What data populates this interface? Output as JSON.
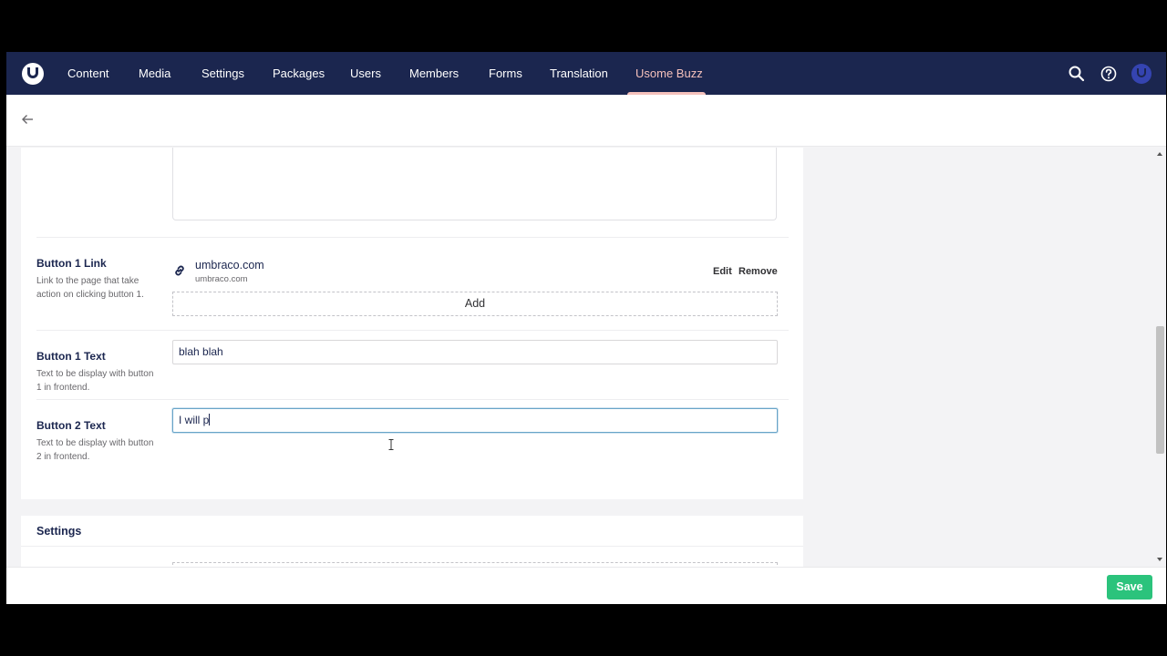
{
  "nav": {
    "items": [
      {
        "label": "Content"
      },
      {
        "label": "Media"
      },
      {
        "label": "Settings"
      },
      {
        "label": "Packages"
      },
      {
        "label": "Users"
      },
      {
        "label": "Members"
      },
      {
        "label": "Forms"
      },
      {
        "label": "Translation"
      },
      {
        "label": "Usome Buzz"
      }
    ],
    "active": "Usome Buzz",
    "icons": [
      "search-icon",
      "help-icon",
      "user-avatar"
    ]
  },
  "properties": {
    "button1_link": {
      "label": "Button 1 Link",
      "description": "Link to the page that take action on clicking button 1.",
      "link_name": "umbraco.com",
      "link_url": "umbraco.com",
      "edit": "Edit",
      "remove": "Remove",
      "add": "Add"
    },
    "button1_text": {
      "label": "Button 1 Text",
      "description": "Text to be display with button 1 in frontend.",
      "value": "blah blah"
    },
    "button2_text": {
      "label": "Button 2 Text",
      "description": "Text to be display with button 2 in frontend.",
      "value": "I will p"
    }
  },
  "settings": {
    "title": "Settings"
  },
  "footer": {
    "save_label": "Save"
  },
  "colors": {
    "topbar": "#1b264f",
    "active_nav": "#f5c1bc",
    "save": "#2bc37c",
    "focus_border": "#68a4c8"
  }
}
